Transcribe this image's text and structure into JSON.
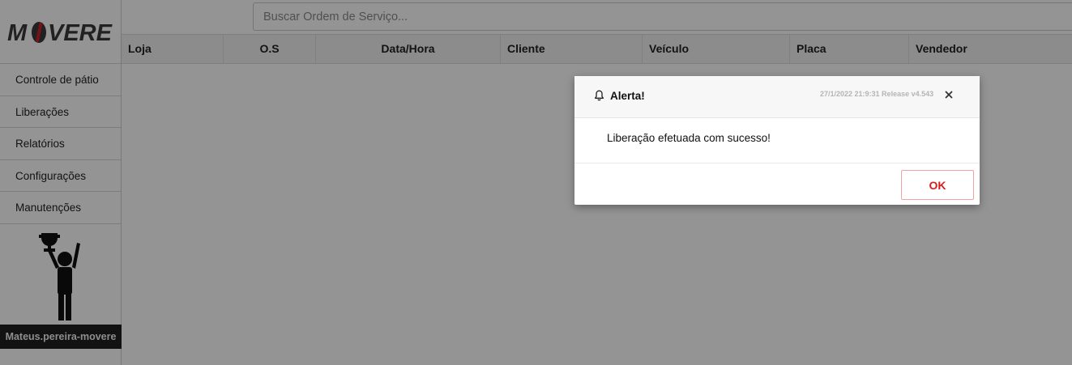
{
  "app": {
    "logo_text": "MOVERE",
    "accent_color": "#c8232c"
  },
  "search": {
    "placeholder": "Buscar Ordem de Serviço..."
  },
  "sidebar": {
    "items": [
      {
        "label": "Controle de pátio"
      },
      {
        "label": "Liberações"
      },
      {
        "label": "Relatórios"
      },
      {
        "label": "Configurações"
      },
      {
        "label": "Manutenções"
      }
    ],
    "avatar_icon": "trophy-person-icon",
    "username": "Mateus.pereira-movere"
  },
  "table": {
    "columns": [
      "Loja",
      "O.S",
      "Data/Hora",
      "Cliente",
      "Veículo",
      "Placa",
      "Vendedor"
    ]
  },
  "modal": {
    "icon": "bell-icon",
    "title": "Alerta!",
    "meta": "27/1/2022 21:9:31 Release v4.543",
    "message": "Liberação efetuada com sucesso!",
    "ok_label": "OK",
    "ok_color": "#d51f1f"
  }
}
